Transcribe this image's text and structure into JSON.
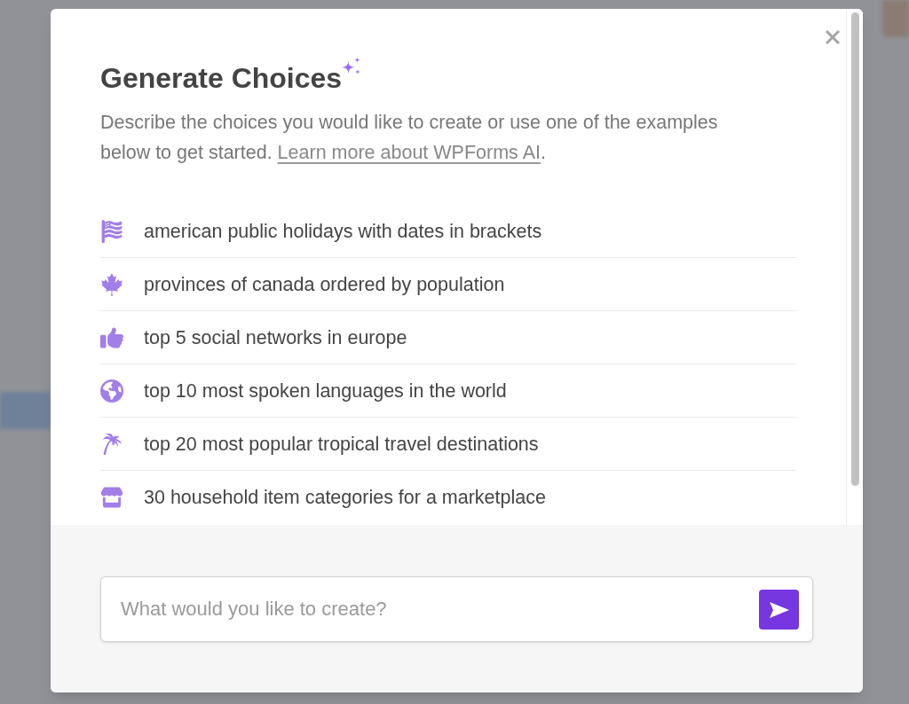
{
  "dialog": {
    "title": "Generate Choices",
    "description": {
      "text": "Describe the choices you would like to create or use one of the examples below to get started.",
      "link": "Learn more about WPForms AI",
      "after": "."
    }
  },
  "examples": [
    {
      "label": "american public holidays with dates in brackets"
    },
    {
      "label": "provinces of canada ordered by population"
    },
    {
      "label": "top 5 social networks in europe"
    },
    {
      "label": "top 10 most spoken languages in the world"
    },
    {
      "label": "top 20 most popular tropical travel destinations"
    },
    {
      "label": "30 household item categories for a marketplace"
    }
  ],
  "prompt": {
    "placeholder": "What would you like to create?"
  }
}
